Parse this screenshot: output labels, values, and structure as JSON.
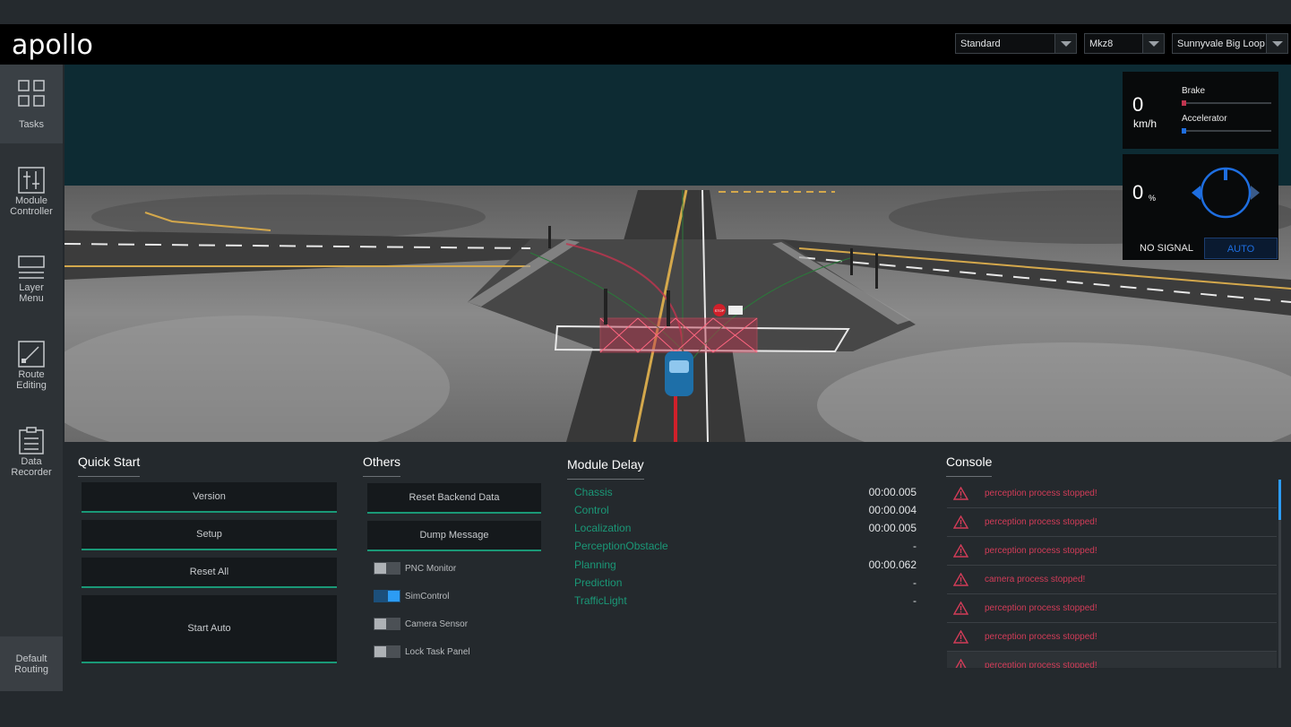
{
  "header": {
    "logo": "apollo",
    "mode_select": {
      "value": "Standard"
    },
    "vehicle_select": {
      "value": "Mkz8"
    },
    "map_select": {
      "value": "Sunnyvale Big Loop"
    }
  },
  "sidebar": {
    "items": [
      {
        "label_1": "Tasks",
        "label_2": ""
      },
      {
        "label_1": "Module",
        "label_2": "Controller"
      },
      {
        "label_1": "Layer",
        "label_2": "Menu"
      },
      {
        "label_1": "Route",
        "label_2": "Editing"
      },
      {
        "label_1": "Data",
        "label_2": "Recorder"
      }
    ],
    "default_routing": {
      "label_1": "Default",
      "label_2": "Routing"
    }
  },
  "scene": {
    "stop_sign_text": "STOP"
  },
  "dashboard": {
    "speed_value": "0",
    "speed_unit": "km/h",
    "brake_label": "Brake",
    "accelerator_label": "Accelerator",
    "brake_level": 0,
    "accelerator_level": 0,
    "steering_value": "0",
    "steering_unit": "%",
    "signal_status": "NO SIGNAL",
    "drive_mode": "AUTO",
    "colors": {
      "brake": "#c0354f",
      "accelerator": "#1e6ee0"
    }
  },
  "quick_start": {
    "title": "Quick Start",
    "buttons": [
      "Version",
      "Setup",
      "Reset All",
      "Start Auto"
    ]
  },
  "others": {
    "title": "Others",
    "buttons": [
      "Reset Backend Data",
      "Dump Message"
    ],
    "toggles": [
      {
        "label": "PNC Monitor",
        "on": false
      },
      {
        "label": "SimControl",
        "on": true
      },
      {
        "label": "Camera Sensor",
        "on": false
      },
      {
        "label": "Lock Task Panel",
        "on": false
      }
    ]
  },
  "module_delay": {
    "title": "Module Delay",
    "rows": [
      {
        "name": "Chassis",
        "value": "00:00.005"
      },
      {
        "name": "Control",
        "value": "00:00.004"
      },
      {
        "name": "Localization",
        "value": "00:00.005"
      },
      {
        "name": "PerceptionObstacle",
        "value": "-"
      },
      {
        "name": "Planning",
        "value": "00:00.062"
      },
      {
        "name": "Prediction",
        "value": "-"
      },
      {
        "name": "TrafficLight",
        "value": "-"
      }
    ]
  },
  "console": {
    "title": "Console",
    "messages": [
      "perception process stopped!",
      "perception process stopped!",
      "perception process stopped!",
      "camera process stopped!",
      "perception process stopped!",
      "perception process stopped!",
      "perception process stopped!"
    ],
    "warning_color": "#d23c58"
  }
}
